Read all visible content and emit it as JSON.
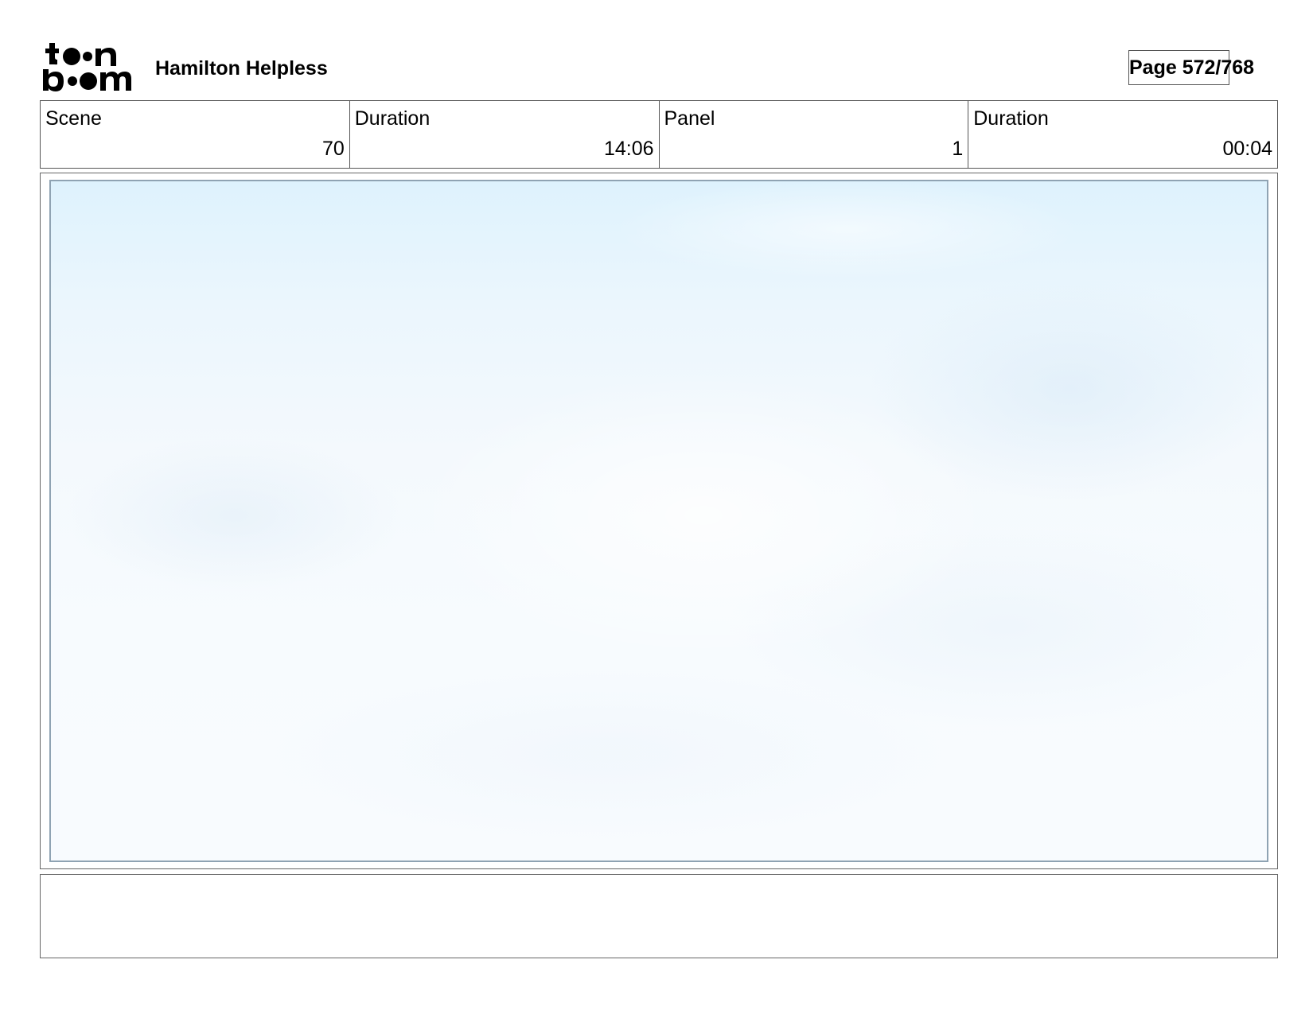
{
  "header": {
    "logo_text": "toon boom",
    "logo_icon": "toon-boom-logo",
    "project_title": "Hamilton Helpless",
    "page_label": "Page 572/768"
  },
  "info": {
    "scene_label": "Scene",
    "scene_value": "70",
    "scene_duration_label": "Duration",
    "scene_duration_value": "14:06",
    "panel_label": "Panel",
    "panel_value": "1",
    "panel_duration_label": "Duration",
    "panel_duration_value": "00:04"
  },
  "panel": {
    "image_description_icon": "sky-clouds-image",
    "colors": {
      "sky_top": "#def2fd",
      "sky_bottom": "#f8fbfe",
      "frame_border": "#8fa3b3"
    }
  },
  "caption": {
    "text": ""
  }
}
